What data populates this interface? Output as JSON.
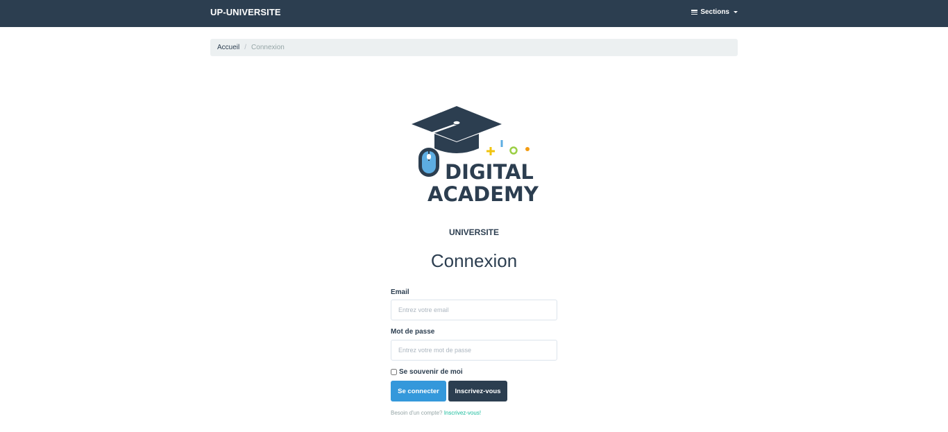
{
  "navbar": {
    "brand": "UP-UNIVERSITE",
    "sections_label": "Sections",
    "sections_icon": "bars-icon",
    "caret_icon": "caret-down-icon",
    "background": "#2c3e50"
  },
  "breadcrumb": {
    "home": "Accueil",
    "separator": "/",
    "current": "Connexion"
  },
  "logo": {
    "line1": "DIGITAL",
    "line2": "ACADEMY",
    "icons": [
      "graduation-cap-icon",
      "computer-mouse-icon"
    ]
  },
  "subtitle": "UNIVERSITE",
  "title": "Connexion",
  "form": {
    "email_label": "Email",
    "email_placeholder": "Entrez votre email",
    "email_value": "",
    "password_label": "Mot de passe",
    "password_placeholder": "Entrez votre mot de passe",
    "password_value": "",
    "remember_label": "Se souvenir de moi",
    "remember_checked": false,
    "login_button": "Se connecter",
    "register_button": "Inscrivez-vous",
    "signup_prompt": "Besoin d'un compte?",
    "signup_link": "Inscrivez-vous!"
  },
  "colors": {
    "primary": "#3498db",
    "dark": "#2c3e50",
    "link": "#18bc9c",
    "breadcrumb_bg": "#ecf0f1"
  }
}
